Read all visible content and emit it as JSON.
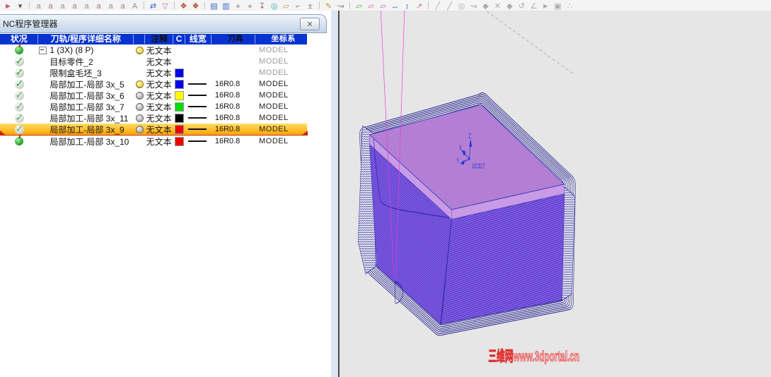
{
  "toolbar": {
    "icons": [
      {
        "name": "select-filter-icon",
        "glyph": "►",
        "color": "#c2566e"
      },
      {
        "name": "dropdown-caret-icon",
        "glyph": "▾",
        "color": "#555555"
      },
      {
        "name": "snap-end-icon",
        "glyph": "a",
        "color": "#8f8f8f"
      },
      {
        "name": "snap-mid-icon",
        "glyph": "a",
        "color": "#a0708f"
      },
      {
        "name": "snap-center-icon",
        "glyph": "a",
        "color": "#8f8f8f"
      },
      {
        "name": "snap-node-icon",
        "glyph": "a",
        "color": "#a0708f"
      },
      {
        "name": "snap-quad-icon",
        "glyph": "a",
        "color": "#8f8f8f"
      },
      {
        "name": "snap-intersect-icon",
        "glyph": "a",
        "color": "#a0708f"
      },
      {
        "name": "snap-perp-icon",
        "glyph": "a",
        "color": "#8f8f8f"
      },
      {
        "name": "snap-tangent-icon",
        "glyph": "a",
        "color": "#a0708f"
      },
      {
        "name": "snap-near-icon",
        "glyph": "A",
        "color": "#8f8f8f"
      },
      {
        "name": "swap-icon",
        "glyph": "⇄",
        "color": "#2b5fd0"
      },
      {
        "name": "filter-funnel-icon",
        "glyph": "▽",
        "color": "#c469b4"
      },
      {
        "name": "grab-icon",
        "glyph": "❖",
        "color": "#b0422a"
      },
      {
        "name": "grab-alt-icon",
        "glyph": "❖",
        "color": "#b0422a"
      },
      {
        "name": "list-icon",
        "glyph": "▤",
        "color": "#3a66c8"
      },
      {
        "name": "list-detail-icon",
        "glyph": "▥",
        "color": "#3a66c8"
      },
      {
        "name": "blob-icon",
        "glyph": "●",
        "color": "#b8b8b8"
      },
      {
        "name": "blob-alt-icon",
        "glyph": "●",
        "color": "#b8b8b8"
      },
      {
        "name": "pin-icon",
        "glyph": "↧",
        "color": "#8a6a6a"
      },
      {
        "name": "node-cyan-icon",
        "glyph": "◎",
        "color": "#3aa8b8"
      },
      {
        "name": "box-tan-icon",
        "glyph": "▱",
        "color": "#c89a5a"
      },
      {
        "name": "measure-height-icon",
        "glyph": "⌐",
        "color": "#777777"
      },
      {
        "name": "measure-add-icon",
        "glyph": "±",
        "color": "#777777"
      },
      {
        "name": "edit-sheet-icon",
        "glyph": "✎",
        "color": "#b8a030"
      },
      {
        "name": "lasso-icon",
        "glyph": "↝",
        "color": "#888888"
      },
      {
        "name": "para-green-icon",
        "glyph": "▱",
        "color": "#5ab04a"
      },
      {
        "name": "para-pink-icon",
        "glyph": "▱",
        "color": "#c86ab8"
      },
      {
        "name": "para-pink-alt-icon",
        "glyph": "▱",
        "color": "#c86ab8"
      },
      {
        "name": "move-xy-icon",
        "glyph": "↔",
        "color": "#3a5fd0"
      },
      {
        "name": "move-z-icon",
        "glyph": "↕",
        "color": "#3a5fd0"
      },
      {
        "name": "rotate-ucs-icon",
        "glyph": "↗",
        "color": "#c86ab8"
      },
      {
        "name": "sketch-line-icon",
        "glyph": "╱",
        "color": "#ababab"
      },
      {
        "name": "sketch-line2-icon",
        "glyph": "╱",
        "color": "#ababab"
      },
      {
        "name": "circle-center-icon",
        "glyph": "◎",
        "color": "#ababab"
      },
      {
        "name": "spline-icon",
        "glyph": "↝",
        "color": "#ababab"
      },
      {
        "name": "surface-icon",
        "glyph": "◆",
        "color": "#ababab"
      },
      {
        "name": "delete-icon",
        "glyph": "✕",
        "color": "#ababab"
      },
      {
        "name": "solid-icon",
        "glyph": "◆",
        "color": "#ababab"
      },
      {
        "name": "undo-curve-icon",
        "glyph": "↺",
        "color": "#ababab"
      },
      {
        "name": "angle-icon",
        "glyph": "∠",
        "color": "#ababab"
      },
      {
        "name": "cursor-icon",
        "glyph": "►",
        "color": "#ababab"
      },
      {
        "name": "frame-dot-icon",
        "glyph": "▣",
        "color": "#ababab"
      },
      {
        "name": "dots-icon",
        "glyph": "∴",
        "color": "#ababab"
      }
    ]
  },
  "panel": {
    "title": "NC程序管理器",
    "close_glyph": "✕",
    "expand_glyph": "−",
    "columns": {
      "status": "状况",
      "name": "刀轨/程序详细名称",
      "bulb": "",
      "comment": "注释",
      "color": "C",
      "linewidth": "线宽",
      "tool": "刀具",
      "csys": "坐标系"
    },
    "rows": [
      {
        "name": "1 (3X) (8 P)",
        "comment": "无文本",
        "color": "",
        "tool": "",
        "csys": "MODEL"
      },
      {
        "name": "目标零件_2",
        "comment": "无文本",
        "color": "",
        "tool": "",
        "csys": "MODEL"
      },
      {
        "name": "限制盒毛坯_3",
        "comment": "无文本",
        "color": "#0000ee",
        "tool": "",
        "csys": "MODEL"
      },
      {
        "name": "局部加工-局部 3x_5",
        "comment": "无文本",
        "color": "#0000ee",
        "tool": "16R0.8",
        "csys": "MODEL"
      },
      {
        "name": "局部加工-局部 3x_6",
        "comment": "无文本",
        "color": "#ffff00",
        "tool": "16R0.8",
        "csys": "MODEL"
      },
      {
        "name": "局部加工-局部 3x_7",
        "comment": "无文本",
        "color": "#00dd00",
        "tool": "16R0.8",
        "csys": "MODEL"
      },
      {
        "name": "局部加工-局部 3x_11",
        "comment": "无文本",
        "color": "#000000",
        "tool": "16R0.8",
        "csys": "MODEL"
      },
      {
        "name": "局部加工-局部 3x_9",
        "comment": "无文本",
        "color": "#ee0000",
        "tool": "16R0.8",
        "csys": "MODEL"
      },
      {
        "name": "局部加工-局部 3x_10",
        "comment": "无文本",
        "color": "#ee0000",
        "tool": "16R0.8",
        "csys": "MODEL"
      }
    ]
  },
  "viewport": {
    "axes": {
      "x": "X",
      "y": "Y",
      "z": "Z",
      "ucs": "UCS17"
    },
    "watermark": "三维网www.3dportal.cn",
    "colors": {
      "background": "#e6e6e6",
      "top_face": "#b27fd4",
      "rim_face": "#c99ae6",
      "side_face": "#8a5ce8",
      "toolpath_line": "#1a1a8c",
      "connect_line": "#e43bd4",
      "watermark_red": "#e03030"
    }
  }
}
